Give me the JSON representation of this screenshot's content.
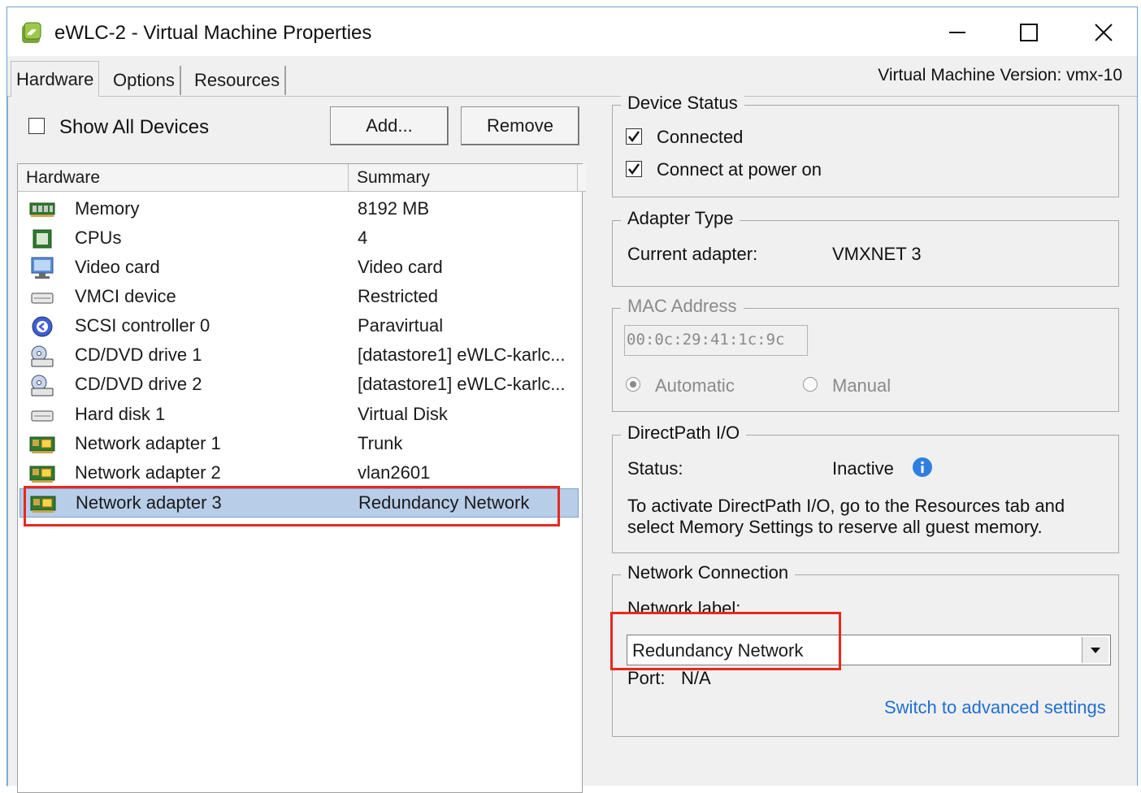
{
  "window": {
    "title": "eWLC-2 - Virtual Machine Properties",
    "vm_version": "Virtual Machine Version: vmx-10"
  },
  "tabs": [
    {
      "label": "Hardware",
      "active": true
    },
    {
      "label": "Options",
      "active": false
    },
    {
      "label": "Resources",
      "active": false
    }
  ],
  "toolbar": {
    "show_all_label": "Show All Devices",
    "show_all_checked": false,
    "add_label": "Add...",
    "remove_label": "Remove"
  },
  "hardware_list": {
    "col_hardware": "Hardware",
    "col_summary": "Summary",
    "rows": [
      {
        "name": "Memory",
        "summary": "8192 MB",
        "icon": "memory-icon"
      },
      {
        "name": "CPUs",
        "summary": "4",
        "icon": "cpu-icon"
      },
      {
        "name": "Video card",
        "summary": "Video card",
        "icon": "monitor-icon"
      },
      {
        "name": "VMCI device",
        "summary": "Restricted",
        "icon": "device-icon"
      },
      {
        "name": "SCSI controller 0",
        "summary": "Paravirtual",
        "icon": "scsi-icon"
      },
      {
        "name": "CD/DVD drive 1",
        "summary": "[datastore1] eWLC-karlc...",
        "icon": "cdrom-icon"
      },
      {
        "name": "CD/DVD drive 2",
        "summary": "[datastore1] eWLC-karlc...",
        "icon": "cdrom-icon"
      },
      {
        "name": "Hard disk 1",
        "summary": "Virtual Disk",
        "icon": "harddisk-icon"
      },
      {
        "name": "Network adapter 1",
        "summary": "Trunk",
        "icon": "network-adapter-icon"
      },
      {
        "name": "Network adapter 2",
        "summary": "vlan2601",
        "icon": "network-adapter-icon"
      },
      {
        "name": "Network adapter 3",
        "summary": "Redundancy Network",
        "icon": "network-adapter-icon",
        "selected": true
      }
    ]
  },
  "device_status": {
    "title": "Device Status",
    "connected_label": "Connected",
    "connected_checked": true,
    "connect_power_label": "Connect at power on",
    "connect_power_checked": true
  },
  "adapter_type": {
    "title": "Adapter Type",
    "current_label": "Current adapter:",
    "current_value": "VMXNET 3"
  },
  "mac_address": {
    "title": "MAC Address",
    "value": "00:0c:29:41:1c:9c",
    "automatic_label": "Automatic",
    "manual_label": "Manual",
    "selected": "Automatic"
  },
  "directpath": {
    "title": "DirectPath I/O",
    "status_label": "Status:",
    "status_value": "Inactive",
    "info_line1": "To activate DirectPath I/O, go to the Resources tab and",
    "info_line2": "select Memory Settings to reserve all guest memory."
  },
  "network_connection": {
    "title": "Network Connection",
    "label_label": "Network label:",
    "selected_network": "Redundancy Network",
    "port_label": "Port:",
    "port_value": "N/A",
    "advanced_link": "Switch to advanced settings"
  },
  "colors": {
    "highlight_box": "#e8281e",
    "selection": "#b8cde8",
    "link": "#1f6fd1"
  }
}
